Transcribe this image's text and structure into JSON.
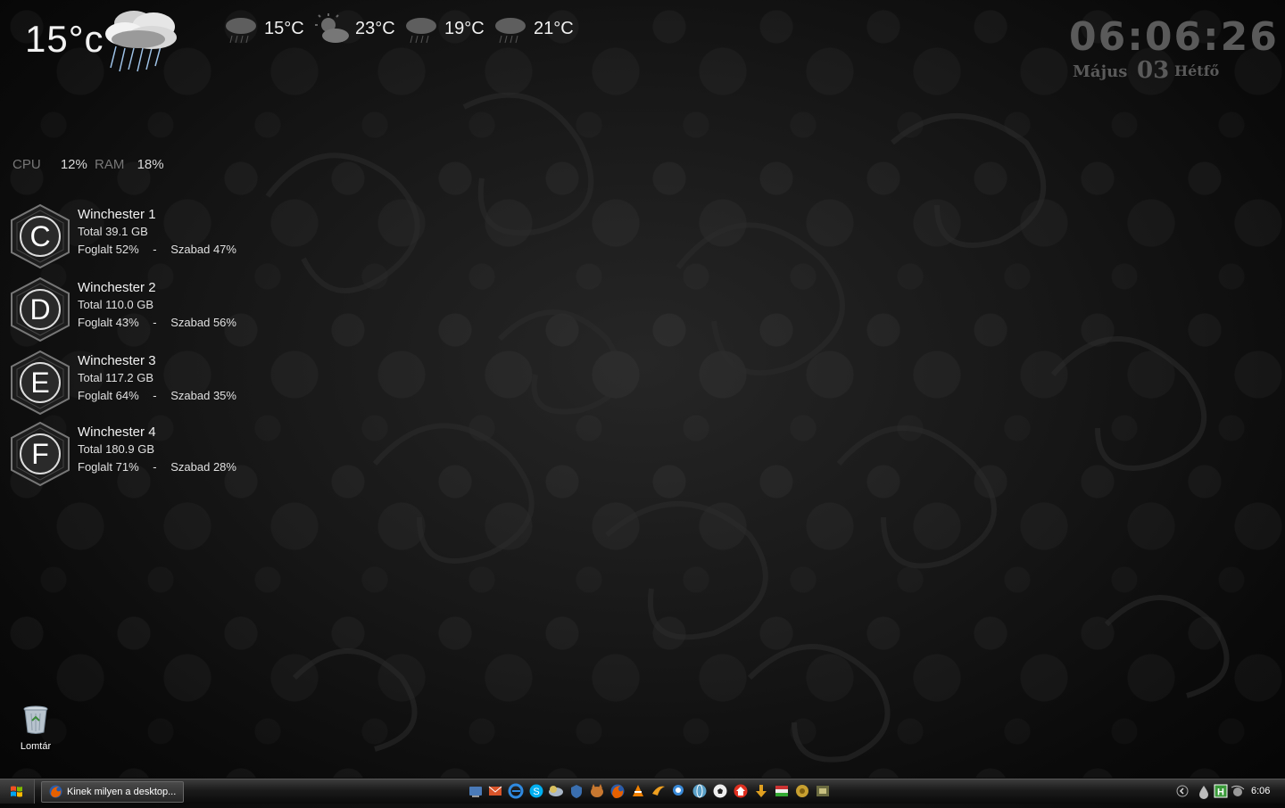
{
  "weather": {
    "current_temp": "15°c",
    "current_icon": "storm-cloud-rain-icon",
    "forecast": [
      {
        "icon": "cloud-rain-icon",
        "temp": "15°C"
      },
      {
        "icon": "partly-cloudy-icon",
        "temp": "23°C"
      },
      {
        "icon": "cloud-rain-icon",
        "temp": "19°C"
      },
      {
        "icon": "cloud-rain-icon",
        "temp": "21°C"
      }
    ]
  },
  "clock": {
    "time": "06:06:26",
    "month": "Május",
    "day": "03",
    "weekday": "Hétfő"
  },
  "system": {
    "cpu_label": "CPU",
    "cpu_value": "12%",
    "ram_label": "RAM",
    "ram_value": "18%"
  },
  "drives": [
    {
      "letter": "C",
      "name": "Winchester 1",
      "total": "Total 39.1 GB",
      "used": "Foglalt 52%",
      "sep": "-",
      "free": "Szabad 47%"
    },
    {
      "letter": "D",
      "name": "Winchester 2",
      "total": "Total 110.0 GB",
      "used": "Foglalt 43%",
      "sep": "-",
      "free": "Szabad 56%"
    },
    {
      "letter": "E",
      "name": "Winchester 3",
      "total": "Total 117.2 GB",
      "used": "Foglalt 64%",
      "sep": "-",
      "free": "Szabad 35%"
    },
    {
      "letter": "F",
      "name": "Winchester 4",
      "total": "Total 180.9 GB",
      "used": "Foglalt 71%",
      "sep": "-",
      "free": "Szabad 28%"
    }
  ],
  "desktop": {
    "recycle_bin_label": "Lomtár"
  },
  "taskbar": {
    "task_button_label": "Kinek milyen a desktop...",
    "quick_launch_icons": [
      "network-icon",
      "mail-icon",
      "internet-explorer-icon",
      "skype-icon",
      "weather-icon",
      "security-icon",
      "cat-icon",
      "firefox-icon",
      "vlc-icon",
      "media-icon",
      "search-icon",
      "globe-icon",
      "soccer-icon",
      "home-icon",
      "download-icon",
      "flag-icon",
      "gold-icon",
      "game-icon"
    ],
    "tray_icons": [
      "show-hidden-icon",
      "drop-icon",
      "utorrent-icon",
      "satellite-icon"
    ],
    "time": "6:06"
  },
  "colors": {
    "background": "#171717",
    "clock_gray": "#5a5a5a",
    "text_light": "#f0f0f0",
    "cpu_label": "#777777"
  }
}
